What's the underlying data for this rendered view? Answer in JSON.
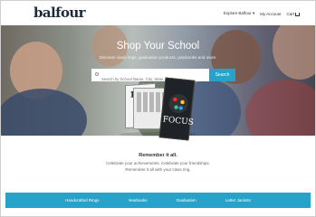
{
  "header": {
    "logo": "balfour",
    "nav": [
      "Explore Balfour",
      "My Account",
      "Cart"
    ]
  },
  "hero": {
    "title": "Shop Your School",
    "subtitle": "Discover class rings, graduation products, yearbooks and more.",
    "search_placeholder": "Search by School Name, City, State, or Zip",
    "search_button": "Search"
  },
  "yearbooks": {
    "left_cover": "10",
    "right_cover": "FOCUS"
  },
  "remember": {
    "heading": "Remember it all.",
    "line1": "Celebrate your achievements. Celebrate your friendships.",
    "line2": "Remember it all with your class ring."
  },
  "categories": [
    "Handcrafted Rings",
    "Yearbooks",
    "Graduation",
    "Letter Jackets"
  ]
}
